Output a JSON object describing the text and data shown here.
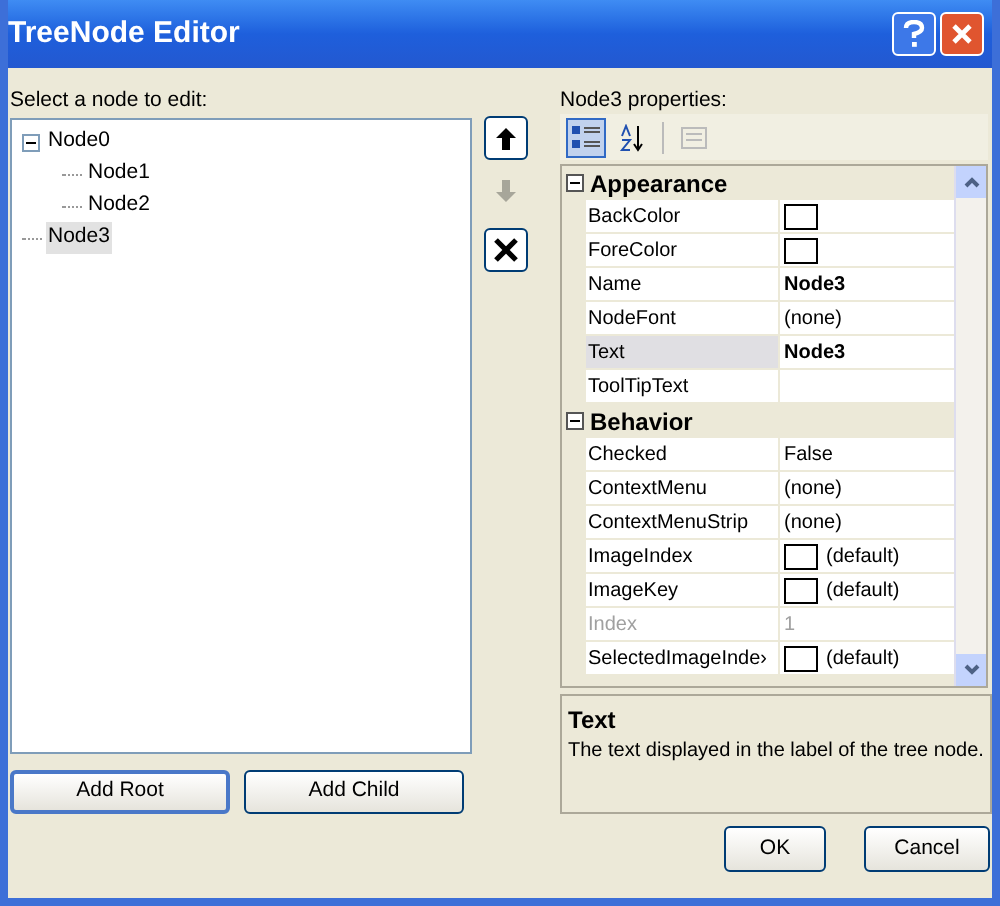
{
  "window": {
    "title": "TreeNode Editor"
  },
  "tree_label": "Select a node to edit:",
  "tree": [
    {
      "label": "Node0",
      "expanded": true,
      "selected": false,
      "children": [
        {
          "label": "Node1",
          "selected": false
        },
        {
          "label": "Node2",
          "selected": false
        }
      ]
    },
    {
      "label": "Node3",
      "selected": true
    }
  ],
  "side_buttons": [
    {
      "kind": "up",
      "disabled": false
    },
    {
      "kind": "down",
      "disabled": true
    },
    {
      "kind": "delete",
      "disabled": false
    }
  ],
  "properties_label": "Node3 properties:",
  "toolbar": [
    {
      "kind": "categorized",
      "selected": true
    },
    {
      "kind": "alphabetical",
      "selected": false
    },
    {
      "kind": "pages",
      "disabled": true
    }
  ],
  "properties": [
    {
      "kind": "category",
      "name": "Appearance",
      "expanded": true
    },
    {
      "kind": "color",
      "name": "BackColor"
    },
    {
      "kind": "color",
      "name": "ForeColor"
    },
    {
      "kind": "text",
      "name": "Name",
      "value": "Node3",
      "bold": true
    },
    {
      "kind": "text",
      "name": "NodeFont",
      "value": "(none)"
    },
    {
      "kind": "text",
      "name": "Text",
      "value": "Node3",
      "bold": true,
      "selected": true
    },
    {
      "kind": "text",
      "name": "ToolTipText"
    },
    {
      "kind": "category",
      "name": "Behavior",
      "expanded": true
    },
    {
      "kind": "text",
      "name": "Checked",
      "value": "False"
    },
    {
      "kind": "text",
      "name": "ContextMenu",
      "value": "(none)"
    },
    {
      "kind": "text",
      "name": "ContextMenuStrip",
      "value": "(none)"
    },
    {
      "kind": "image",
      "name": "ImageIndex",
      "value": "(default)"
    },
    {
      "kind": "image",
      "name": "ImageKey",
      "value": "(default)"
    },
    {
      "kind": "text",
      "name": "Index",
      "value": "1",
      "disabled": true
    },
    {
      "kind": "image",
      "name": "SelectedImageInde›",
      "value": "(default)"
    }
  ],
  "description": {
    "title": "Text",
    "text": "The text displayed in the label of the tree node."
  },
  "tree_buttons": [
    "Add Root",
    "Add Child"
  ],
  "dialog_buttons": [
    "OK",
    "Cancel"
  ]
}
